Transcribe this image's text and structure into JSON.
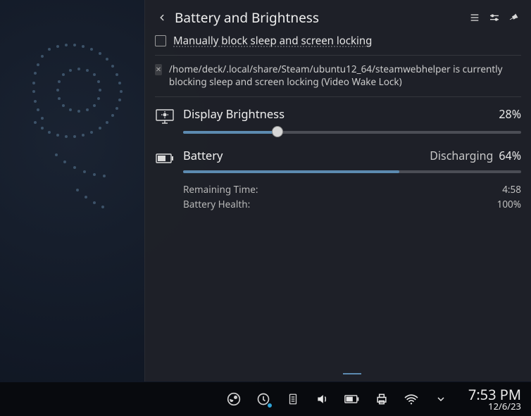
{
  "popup": {
    "title": "Battery and Brightness",
    "block_sleep_label": "Manually block sleep and screen locking",
    "block_sleep_checked": false,
    "wake_lock_message": "/home/deck/.local/share/Steam/ubuntu12_64/steamwebhelper is currently blocking sleep and screen locking (Video Wake Lock)"
  },
  "brightness": {
    "title": "Display Brightness",
    "percent_label": "28%",
    "percent": 28
  },
  "battery": {
    "title": "Battery",
    "status": "Discharging",
    "percent_label": "64%",
    "percent": 64,
    "remaining_label": "Remaining Time:",
    "remaining_value": "4:58",
    "health_label": "Battery Health:",
    "health_value": "100%"
  },
  "clock": {
    "time": "7:53 PM",
    "date": "12/6/23"
  },
  "icons": {
    "back": "back-icon",
    "hamburger": "hamburger-icon",
    "sliders": "sliders-icon",
    "pin": "pin-icon",
    "info": "info-icon",
    "brightness": "brightness-monitor-icon",
    "battery": "battery-icon"
  }
}
